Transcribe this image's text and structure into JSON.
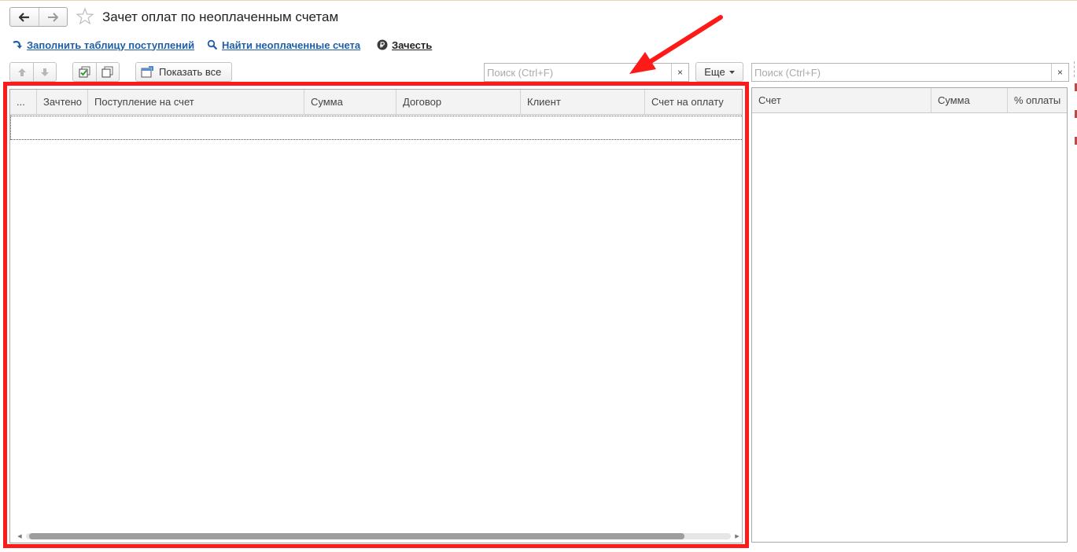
{
  "window": {
    "title": "Зачет оплат по неоплаченным счетам"
  },
  "commands": {
    "fill_table": "Заполнить таблицу поступлений",
    "find_unpaid": "Найти неоплаченные счета",
    "zachest": "Зачесть"
  },
  "toolbar": {
    "show_all": "Показать все",
    "more": "Еще",
    "search_placeholder": "Поиск (Ctrl+F)",
    "clear_symbol": "×"
  },
  "payments_table": {
    "columns": [
      "...",
      "Зачтено",
      "Поступление на счет",
      "Сумма",
      "Договор",
      "Клиент",
      "Счет на оплату"
    ],
    "rows": []
  },
  "invoices_table": {
    "search_placeholder": "Поиск (Ctrl+F)",
    "columns": [
      "Счет",
      "Сумма",
      "% оплаты"
    ],
    "rows": []
  },
  "colors": {
    "link": "#1f5fa6",
    "highlight": "#ff1a1a",
    "header_bg": "#f3f3f3"
  },
  "icons": {
    "back": "arrow-left-icon",
    "forward": "arrow-right-icon",
    "favorite": "star-icon",
    "fill": "fill-arrow-icon",
    "find": "magnifier-icon",
    "zachest": "ruble-icon",
    "move_up": "arrow-up-icon",
    "move_down": "arrow-down-icon",
    "check_all": "check-all-icon",
    "uncheck_all": "uncheck-all-icon",
    "show_all": "show-all-icon"
  }
}
